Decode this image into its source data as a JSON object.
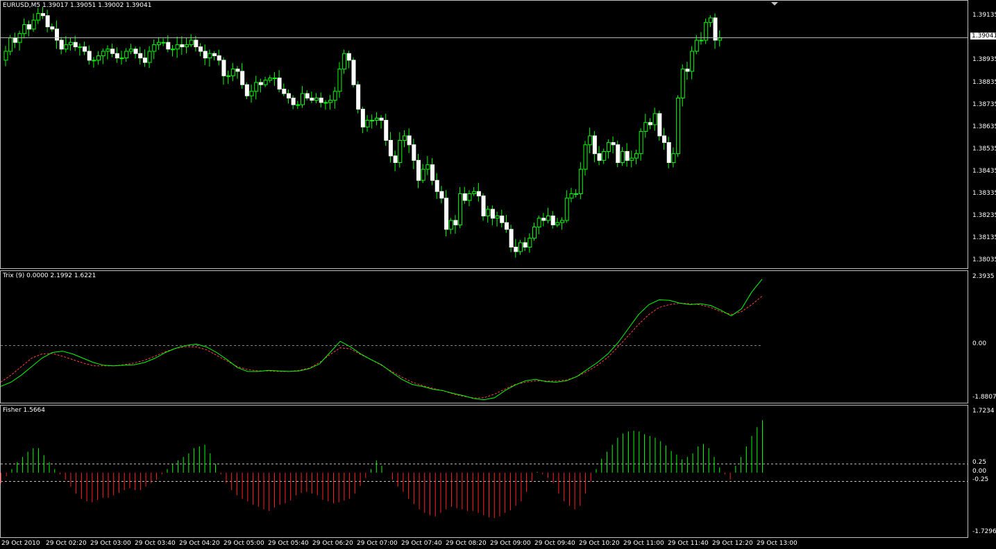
{
  "window": {
    "title": "EURUSD,M5  1.39017 1.39051 1.39002 1.39041",
    "symbol": "EURUSD",
    "timeframe": "M5"
  },
  "colors": {
    "background": "#000000",
    "bull": "#00ff00",
    "bear": "#ffffff",
    "trix": "#00ff00",
    "trix_signal": "#ff4040",
    "fisher_up": "#00ff00",
    "fisher_down": "#ff2020",
    "grid": "#c0c0c0"
  },
  "price_pane": {
    "price_ticks": [
      "1.39135",
      "1.38935",
      "1.38835",
      "1.38735",
      "1.38635",
      "1.38535",
      "1.38435",
      "1.38335",
      "1.38235",
      "1.38135",
      "1.38035"
    ],
    "current_price": "1.39041"
  },
  "trix_pane": {
    "title": "Trix (9) 0.0000 2.1992 1.6221",
    "ticks": [
      "2.3935",
      "0.00",
      "-1.8807"
    ]
  },
  "fisher_pane": {
    "title": "Fisher 1.5664",
    "ticks": [
      "1.7234",
      "0.25",
      "0.00",
      "-0.25",
      "-1.7296"
    ]
  },
  "time_axis": [
    "29 Oct 2010",
    "29 Oct 02:20",
    "29 Oct 03:00",
    "29 Oct 03:40",
    "29 Oct 04:20",
    "29 Oct 05:00",
    "29 Oct 05:40",
    "29 Oct 06:20",
    "29 Oct 07:00",
    "29 Oct 07:40",
    "29 Oct 08:20",
    "29 Oct 09:00",
    "29 Oct 09:40",
    "29 Oct 10:20",
    "29 Oct 11:00",
    "29 Oct 11:40",
    "29 Oct 12:20",
    "29 Oct 13:00"
  ],
  "chart_data": [
    {
      "type": "candlestick",
      "title": "EURUSD,M5  1.39017 1.39051 1.39002 1.39041",
      "ylim": [
        1.38005,
        1.39195
      ],
      "close": [
        1.3898,
        1.3904,
        1.3902,
        1.3906,
        1.391,
        1.3908,
        1.3912,
        1.3915,
        1.3914,
        1.3909,
        1.3908,
        1.3903,
        1.3899,
        1.3901,
        1.3902,
        1.39,
        1.39,
        1.3898,
        1.3894,
        1.3894,
        1.3896,
        1.3898,
        1.3899,
        1.3897,
        1.3895,
        1.3895,
        1.3898,
        1.3899,
        1.3897,
        1.3895,
        1.3893,
        1.3898,
        1.3901,
        1.3902,
        1.3902,
        1.3899,
        1.3899,
        1.3901,
        1.39,
        1.3901,
        1.3903,
        1.39,
        1.3898,
        1.3895,
        1.3897,
        1.3896,
        1.3894,
        1.3887,
        1.3887,
        1.389,
        1.3889,
        1.3883,
        1.3878,
        1.388,
        1.3884,
        1.3883,
        1.3885,
        1.3886,
        1.3886,
        1.3881,
        1.3879,
        1.3877,
        1.3874,
        1.3874,
        1.3879,
        1.3877,
        1.3876,
        1.3877,
        1.3875,
        1.3875,
        1.3876,
        1.388,
        1.389,
        1.3897,
        1.3894,
        1.3883,
        1.3872,
        1.3864,
        1.3867,
        1.3867,
        1.3868,
        1.3867,
        1.3858,
        1.3851,
        1.3848,
        1.3858,
        1.386,
        1.3856,
        1.3849,
        1.384,
        1.3845,
        1.3847,
        1.384,
        1.3835,
        1.3832,
        1.3818,
        1.3822,
        1.382,
        1.3834,
        1.3831,
        1.3834,
        1.3835,
        1.3833,
        1.3824,
        1.3827,
        1.3823,
        1.3824,
        1.3821,
        1.3818,
        1.381,
        1.3808,
        1.3812,
        1.381,
        1.3814,
        1.3819,
        1.3823,
        1.3822,
        1.3824,
        1.382,
        1.3821,
        1.3822,
        1.3832,
        1.3834,
        1.3834,
        1.3845,
        1.3856,
        1.386,
        1.3852,
        1.3849,
        1.3853,
        1.3857,
        1.3856,
        1.3848,
        1.3853,
        1.3849,
        1.385,
        1.3852,
        1.3862,
        1.3866,
        1.3865,
        1.387,
        1.386,
        1.3857,
        1.3848,
        1.3852,
        1.3877,
        1.389,
        1.3889,
        1.3898,
        1.3903,
        1.3903,
        1.3911,
        1.3913,
        1.3903,
        1.3904
      ]
    },
    {
      "type": "line",
      "title": "Trix (9) 0.0000 2.1992 1.6221",
      "ylim": [
        -1.8807,
        2.3935
      ],
      "series": [
        {
          "values": [
            -1.45,
            -1.3,
            -1.05,
            -0.75,
            -0.45,
            -0.25,
            -0.2,
            -0.3,
            -0.45,
            -0.6,
            -0.7,
            -0.72,
            -0.7,
            -0.68,
            -0.6,
            -0.45,
            -0.25,
            -0.1,
            0.0,
            0.05,
            -0.05,
            -0.25,
            -0.5,
            -0.78,
            -0.92,
            -0.92,
            -0.88,
            -0.9,
            -0.92,
            -0.9,
            -0.82,
            -0.65,
            -0.25,
            0.15,
            -0.05,
            -0.3,
            -0.5,
            -0.68,
            -0.95,
            -1.2,
            -1.38,
            -1.45,
            -1.55,
            -1.6,
            -1.7,
            -1.78,
            -1.88,
            -1.92,
            -1.85,
            -1.6,
            -1.4,
            -1.25,
            -1.2,
            -1.28,
            -1.3,
            -1.25,
            -1.1,
            -0.85,
            -0.6,
            -0.3,
            0.1,
            0.6,
            1.1,
            1.45,
            1.62,
            1.6,
            1.5,
            1.45,
            1.48,
            1.42,
            1.25,
            1.05,
            1.3,
            1.9,
            2.35
          ]
        },
        {
          "values": [
            -1.3,
            -1.05,
            -0.75,
            -0.45,
            -0.3,
            -0.28,
            -0.38,
            -0.5,
            -0.62,
            -0.72,
            -0.72,
            -0.72,
            -0.68,
            -0.62,
            -0.52,
            -0.38,
            -0.22,
            -0.1,
            -0.04,
            -0.05,
            -0.15,
            -0.35,
            -0.55,
            -0.75,
            -0.85,
            -0.9,
            -0.9,
            -0.92,
            -0.92,
            -0.88,
            -0.8,
            -0.6,
            -0.32,
            -0.08,
            -0.12,
            -0.32,
            -0.5,
            -0.7,
            -0.92,
            -1.12,
            -1.3,
            -1.42,
            -1.52,
            -1.6,
            -1.72,
            -1.8,
            -1.86,
            -1.85,
            -1.72,
            -1.55,
            -1.38,
            -1.3,
            -1.25,
            -1.26,
            -1.26,
            -1.22,
            -1.1,
            -0.92,
            -0.7,
            -0.42,
            -0.05,
            0.35,
            0.75,
            1.1,
            1.35,
            1.45,
            1.5,
            1.48,
            1.44,
            1.35,
            1.2,
            1.1,
            1.2,
            1.45,
            1.75
          ]
        }
      ]
    },
    {
      "type": "bar",
      "title": "Fisher 1.5664",
      "ylim": [
        -1.7296,
        1.7234
      ],
      "values": [
        -0.3,
        -0.1,
        0.1,
        0.3,
        0.45,
        0.6,
        0.7,
        0.7,
        0.5,
        0.3,
        0.1,
        -0.05,
        -0.2,
        -0.4,
        -0.6,
        -0.75,
        -0.82,
        -0.85,
        -0.78,
        -0.72,
        -0.72,
        -0.65,
        -0.58,
        -0.5,
        -0.45,
        -0.5,
        -0.5,
        -0.4,
        -0.3,
        -0.2,
        -0.05,
        0.1,
        0.25,
        0.35,
        0.45,
        0.55,
        0.7,
        0.75,
        0.8,
        0.55,
        0.25,
        -0.05,
        -0.3,
        -0.5,
        -0.65,
        -0.75,
        -0.82,
        -0.92,
        -0.98,
        -1.05,
        -1.1,
        -1.0,
        -0.92,
        -0.88,
        -0.8,
        -0.65,
        -0.58,
        -0.55,
        -0.6,
        -0.65,
        -0.78,
        -0.82,
        -0.88,
        -0.85,
        -0.8,
        -0.75,
        -0.6,
        -0.38,
        -0.15,
        0.1,
        0.35,
        0.2,
        0.0,
        -0.2,
        -0.4,
        -0.55,
        -0.75,
        -0.9,
        -1.05,
        -1.15,
        -1.22,
        -1.25,
        -1.15,
        -1.05,
        -0.98,
        -1.02,
        -1.05,
        -1.1,
        -1.1,
        -1.15,
        -1.22,
        -1.28,
        -1.3,
        -1.25,
        -1.15,
        -1.08,
        -0.95,
        -0.82,
        -0.55,
        -0.25,
        0.02,
        -0.05,
        -0.15,
        -0.3,
        -0.6,
        -0.82,
        -0.95,
        -1.05,
        -0.95,
        -0.6,
        -0.25,
        0.1,
        0.4,
        0.6,
        0.8,
        1.0,
        1.12,
        1.18,
        1.2,
        1.18,
        1.1,
        1.05,
        1.0,
        0.9,
        0.78,
        0.62,
        0.52,
        0.38,
        0.45,
        0.55,
        0.75,
        0.82,
        0.7,
        0.45,
        0.15,
        -0.05,
        -0.2,
        0.2,
        0.45,
        0.75,
        1.05,
        1.3,
        1.5
      ]
    }
  ]
}
